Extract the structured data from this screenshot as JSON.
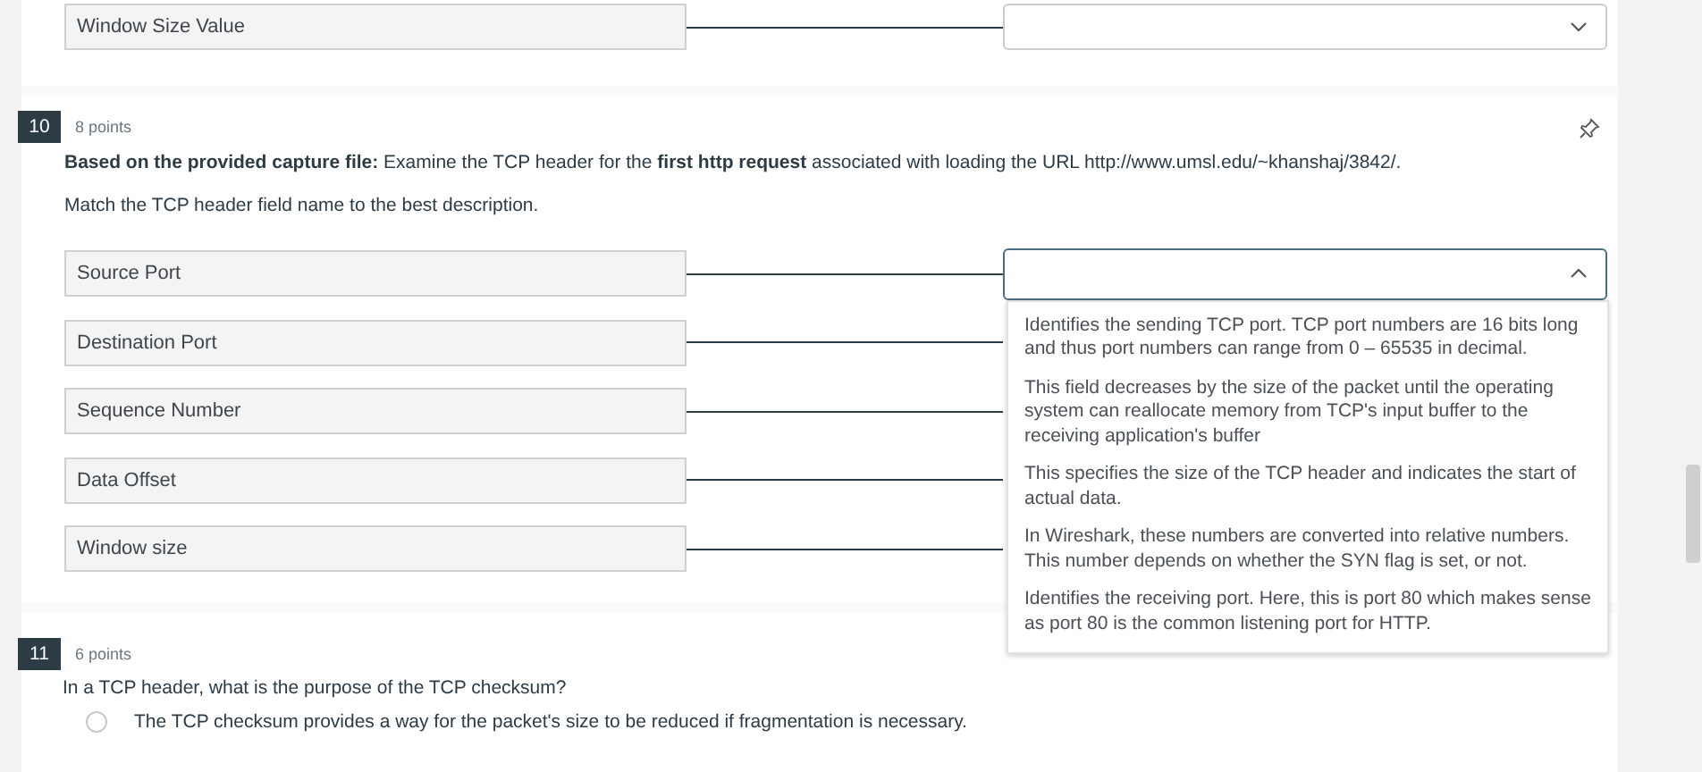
{
  "previous_question": {
    "rows": [
      {
        "field": "Window Size Value",
        "select": {
          "expanded": false
        }
      }
    ]
  },
  "question_10": {
    "number": "10",
    "points": "8 points",
    "prompt": "**Based on the provided capture file:** Examine the TCP header for the **first http request** associated with loading the URL http://www.umsl.edu/~khanshaj/3842/.",
    "instruction": "Match the TCP header field name to the best description.",
    "rows": [
      {
        "field": "Source Port",
        "select": {
          "expanded": true,
          "options": [
            "Identifies the sending TCP port. TCP port numbers are 16 bits long and thus port numbers can range from 0 – 65535 in decimal.",
            "This field decreases by the size of the packet until the operating system can reallocate memory from TCP's input buffer to the receiving application's buffer",
            "This specifies the size of the TCP header and indicates the start of actual data.",
            "In Wireshark, these numbers are converted into relative numbers. This number depends on whether the SYN flag is set, or not.",
            "Identifies the receiving port. Here, this is port 80 which makes sense as port 80 is the common listening port for HTTP."
          ]
        }
      },
      {
        "field": "Destination Port"
      },
      {
        "field": "Sequence Number"
      },
      {
        "field": "Data Offset"
      },
      {
        "field": "Window size"
      }
    ]
  },
  "question_11": {
    "number": "11",
    "points": "6 points",
    "prompt": "In a TCP header, what is the purpose of the TCP checksum?",
    "options": [
      {
        "text": "The TCP checksum provides a way for the packet's size to be reduced if fragmentation is necessary.",
        "selected": false
      }
    ]
  }
}
